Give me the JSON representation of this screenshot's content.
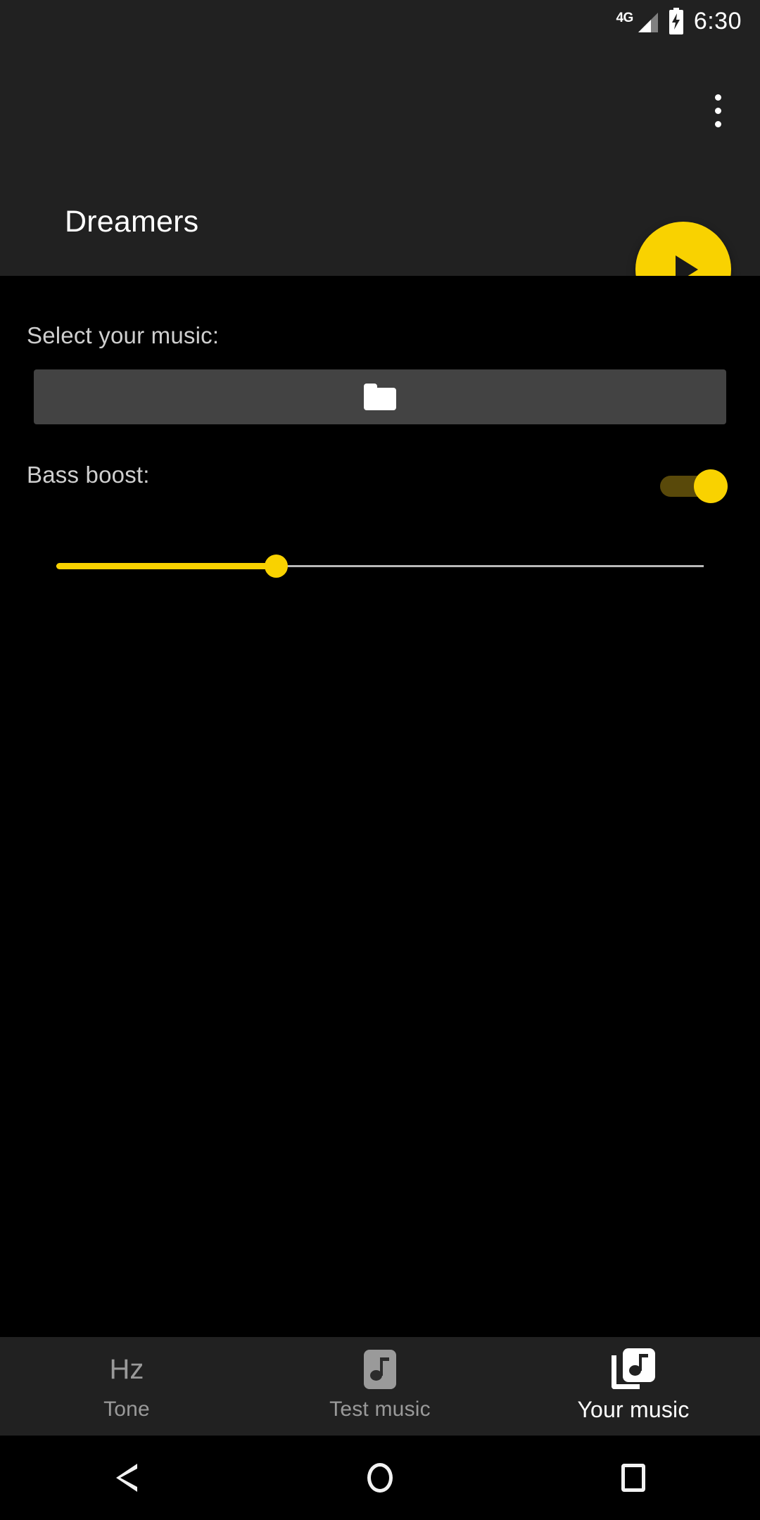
{
  "status_bar": {
    "network_label": "4G",
    "signal_icon": "signal-bars-icon",
    "battery_icon": "battery-charging-icon",
    "time": "6:30"
  },
  "app_bar": {
    "title": "Dreamers",
    "overflow_icon": "more-vert-icon",
    "background_color": "#212121"
  },
  "fab": {
    "icon": "play-icon",
    "color": "#f9d200"
  },
  "content": {
    "select_music": {
      "label": "Select your music:",
      "button_icon": "folder-icon",
      "button_color": "#434343"
    },
    "bass_boost": {
      "label": "Bass boost:",
      "toggle_state": "on",
      "toggle_thumb_color": "#f9d200",
      "toggle_track_color": "#59490a"
    },
    "bass_slider": {
      "value_percent": 34,
      "min": 0,
      "max": 100,
      "fill_color": "#f9d200",
      "track_color": "#b9b9b9"
    }
  },
  "bottom_nav": {
    "items": [
      {
        "label": "Tone",
        "icon": "hz-icon",
        "icon_text": "Hz",
        "active": false
      },
      {
        "label": "Test music",
        "icon": "music-note-icon",
        "active": false
      },
      {
        "label": "Your music",
        "icon": "library-music-icon",
        "active": true
      }
    ]
  },
  "android_nav": {
    "back_icon": "back-triangle-icon",
    "home_icon": "home-circle-icon",
    "recents_icon": "recents-square-icon"
  }
}
